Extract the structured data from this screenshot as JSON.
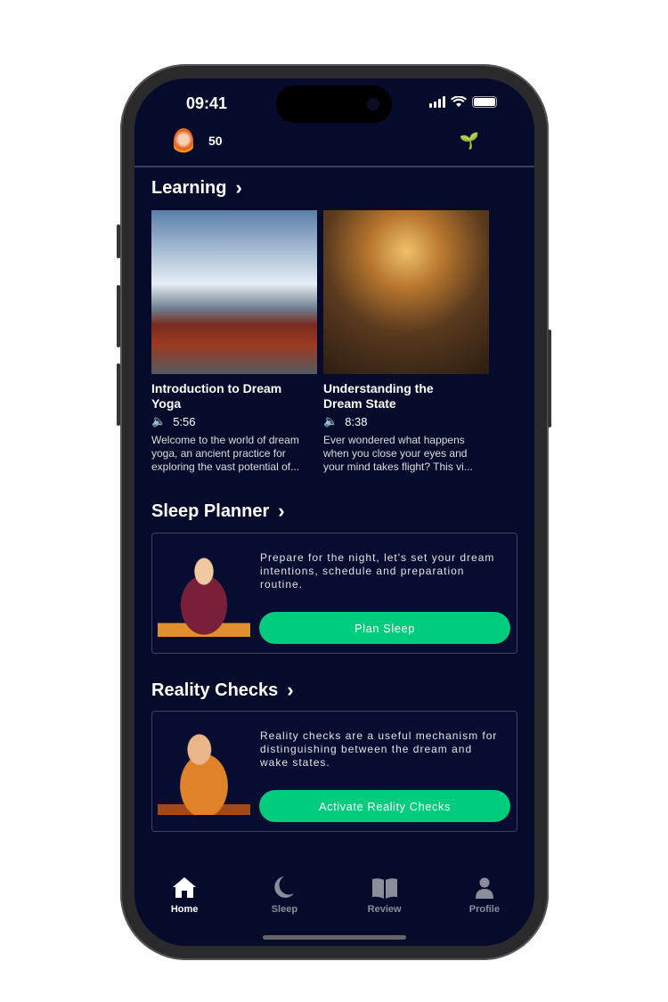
{
  "status_bar": {
    "time": "09:41"
  },
  "header": {
    "streak_count": "50",
    "avatar_icon": "fire-monk-avatar",
    "sprout_icon": "sprout-icon"
  },
  "learning": {
    "title": "Learning",
    "cards": [
      {
        "title": "Introduction to Dream Yoga",
        "duration": "5:56",
        "description": "Welcome to the world of dream yoga, an ancient practice for exploring the vast potential of..."
      },
      {
        "title": "Understanding the Dream State",
        "duration": "8:38",
        "description": "Ever wondered what happens when you close your eyes and your mind takes flight? This vi..."
      }
    ]
  },
  "sleep_planner": {
    "title": "Sleep Planner",
    "text": "Prepare for the night, let's set your dream intentions, schedule and preparation routine.",
    "button": "Plan Sleep"
  },
  "reality_checks": {
    "title": "Reality Checks",
    "text": "Reality checks are a useful mechanism for distinguishing between the dream and wake states.",
    "button": "Activate Reality Checks"
  },
  "tabs": [
    {
      "label": "Home",
      "active": true
    },
    {
      "label": "Sleep"
    },
    {
      "label": "Review"
    },
    {
      "label": "Profile"
    }
  ],
  "colors": {
    "background": "#060b2b",
    "accent": "#00cc7d"
  }
}
